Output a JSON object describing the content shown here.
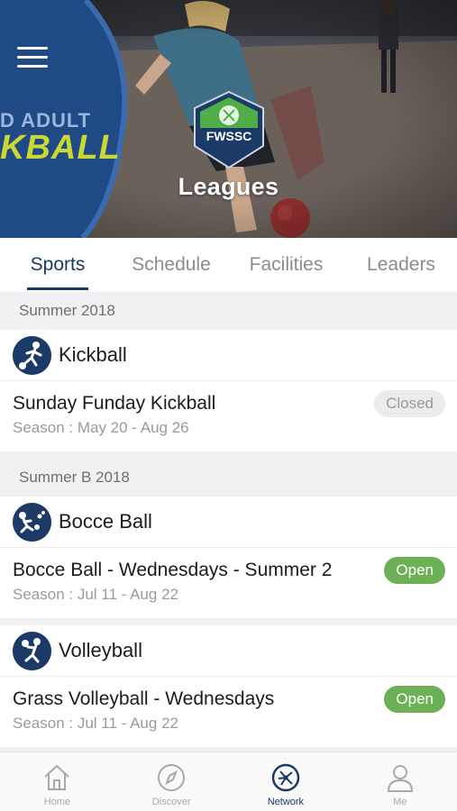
{
  "hero": {
    "banner_text_line1": "D ADULT",
    "banner_text_line2": "KBALL",
    "logo_text": "FWSSC",
    "title": "Leagues"
  },
  "tabs": [
    {
      "label": "Sports",
      "active": true
    },
    {
      "label": "Schedule",
      "active": false
    },
    {
      "label": "Facilities",
      "active": false
    },
    {
      "label": "Leaders",
      "active": false
    }
  ],
  "sections": [
    {
      "header": "Summer 2018",
      "sports": [
        {
          "sport": "Kickball",
          "icon": "kickball-icon",
          "league": "Sunday Funday Kickball",
          "season": "Season : May 20 - Aug 26",
          "status": "Closed"
        }
      ]
    },
    {
      "header": "Summer B 2018",
      "sports": [
        {
          "sport": "Bocce Ball",
          "icon": "bocce-icon",
          "league": "Bocce Ball - Wednesdays - Summer 2",
          "season": "Season : Jul 11 - Aug 22",
          "status": "Open"
        },
        {
          "sport": "Volleyball",
          "icon": "volleyball-icon",
          "league": "Grass Volleyball - Wednesdays",
          "season": "Season : Jul 11 - Aug 22",
          "status": "Open"
        }
      ]
    }
  ],
  "bottom_nav": [
    {
      "label": "Home",
      "icon": "home-icon",
      "active": false
    },
    {
      "label": "Discover",
      "icon": "compass-icon",
      "active": false
    },
    {
      "label": "Network",
      "icon": "network-icon",
      "active": true
    },
    {
      "label": "Me",
      "icon": "user-icon",
      "active": false
    }
  ],
  "colors": {
    "brand_navy": "#1b3a67",
    "open_green": "#6db055",
    "closed_gray": "#ececec",
    "logo_green": "#4fae48"
  }
}
